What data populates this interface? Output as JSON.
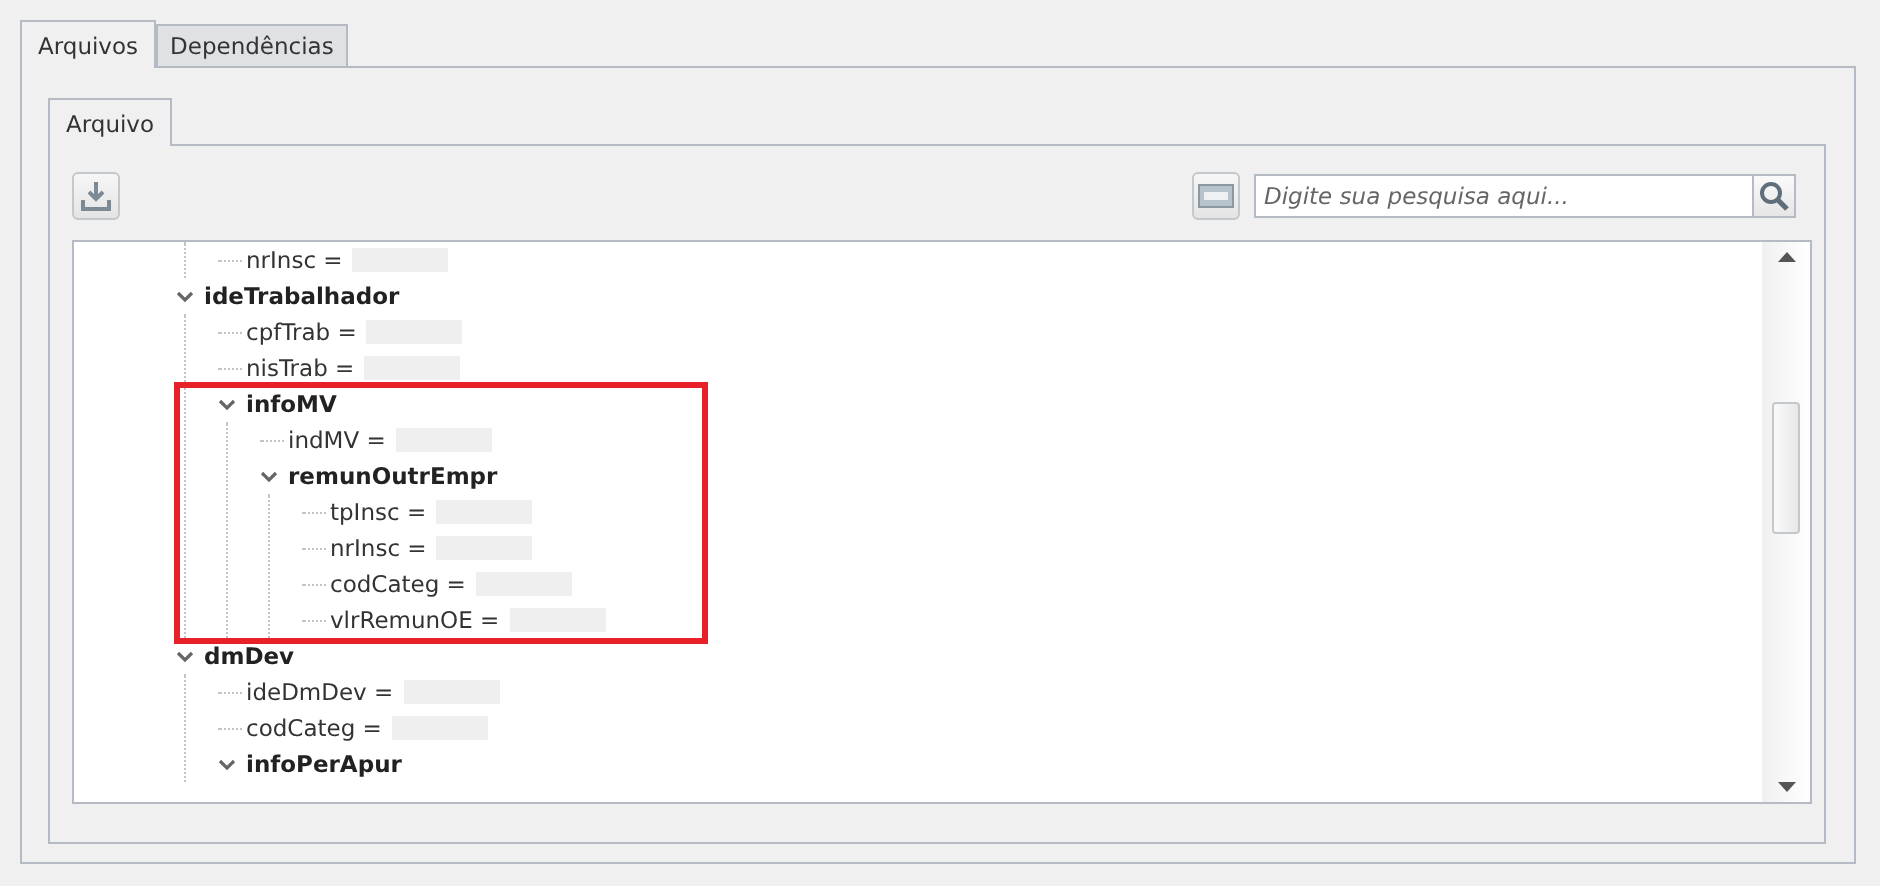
{
  "tabs": [
    {
      "label": "Arquivos",
      "selected": true
    },
    {
      "label": "Dependências",
      "selected": false
    }
  ],
  "inner_tabs": [
    {
      "label": "Arquivo",
      "selected": true
    }
  ],
  "search": {
    "placeholder": "Digite sua pesquisa aqui..."
  },
  "tree": {
    "continued": [
      {
        "kind": "field",
        "label": "nrInsc =",
        "masked": true
      }
    ],
    "nodes": [
      {
        "kind": "group",
        "label": "ideTrabalhador",
        "expanded": true,
        "children": [
          {
            "kind": "field",
            "label": "cpfTrab =",
            "masked": true
          },
          {
            "kind": "field",
            "label": "nisTrab =",
            "masked": true
          },
          {
            "kind": "group",
            "label": "infoMV",
            "expanded": true,
            "highlighted": true,
            "children": [
              {
                "kind": "field",
                "label": "indMV =",
                "masked": true
              },
              {
                "kind": "group",
                "label": "remunOutrEmpr",
                "expanded": true,
                "children": [
                  {
                    "kind": "field",
                    "label": "tpInsc =",
                    "masked": true
                  },
                  {
                    "kind": "field",
                    "label": "nrInsc =",
                    "masked": true
                  },
                  {
                    "kind": "field",
                    "label": "codCateg =",
                    "masked": true
                  },
                  {
                    "kind": "field",
                    "label": "vlrRemunOE =",
                    "masked": true
                  }
                ]
              }
            ]
          }
        ]
      },
      {
        "kind": "group",
        "label": "dmDev",
        "expanded": true,
        "children": [
          {
            "kind": "field",
            "label": "ideDmDev =",
            "masked": true
          },
          {
            "kind": "field",
            "label": "codCateg =",
            "masked": true
          },
          {
            "kind": "group",
            "label": "infoPerApur",
            "expanded": true
          }
        ]
      }
    ]
  }
}
